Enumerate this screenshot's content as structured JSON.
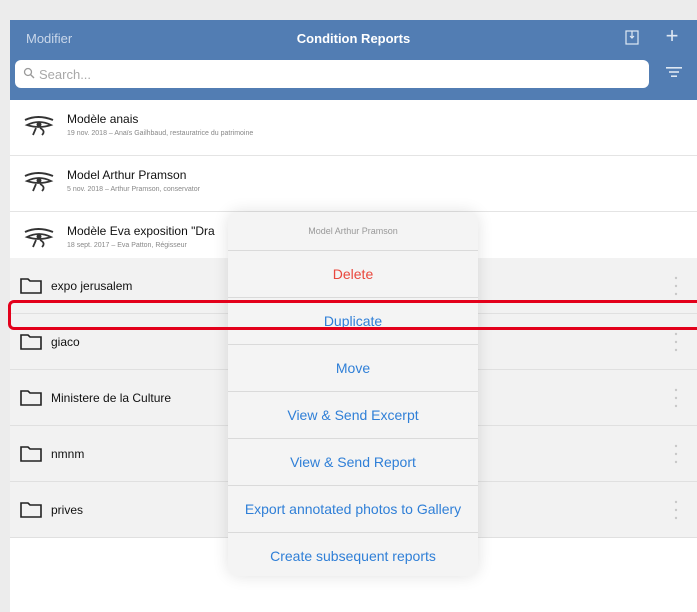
{
  "nav": {
    "left_label": "Modifier",
    "title": "Condition Reports"
  },
  "search": {
    "placeholder": "Search..."
  },
  "reports": [
    {
      "title": "Modèle anais",
      "subtitle": "19 nov. 2018 – Anaïs Gailhbaud, restauratrice du patrimoine"
    },
    {
      "title": "Model Arthur Pramson",
      "subtitle": "5 nov. 2018 – Arthur Pramson, conservator"
    },
    {
      "title": "Modèle Eva exposition \"Dra",
      "subtitle": "18 sept. 2017 – Eva Patton, Régisseur"
    }
  ],
  "folders": [
    {
      "label": "expo jerusalem"
    },
    {
      "label": "giaco"
    },
    {
      "label": "Ministere de la Culture"
    },
    {
      "label": "nmnm"
    },
    {
      "label": "prives"
    }
  ],
  "menu": {
    "header": "Model Arthur Pramson",
    "items": [
      {
        "label": "Delete"
      },
      {
        "label": "Duplicate"
      },
      {
        "label": "Move"
      },
      {
        "label": "View & Send Excerpt"
      },
      {
        "label": "View & Send Report"
      },
      {
        "label": "Export annotated photos to Gallery"
      },
      {
        "label": "Create subsequent reports"
      }
    ]
  },
  "icons": {
    "report_row": "eye-of-horus-icon",
    "folder_row": "folder-icon",
    "row_actions": "more-vertical-icon",
    "search": "search-icon",
    "filter": "filter-icon",
    "inbox": "inbox-icon",
    "add": "plus-icon"
  },
  "colors": {
    "navbar": "#527db3",
    "menu_action": "#2f7fd7",
    "menu_destructive": "#e9473d",
    "highlight": "#e3001b"
  }
}
